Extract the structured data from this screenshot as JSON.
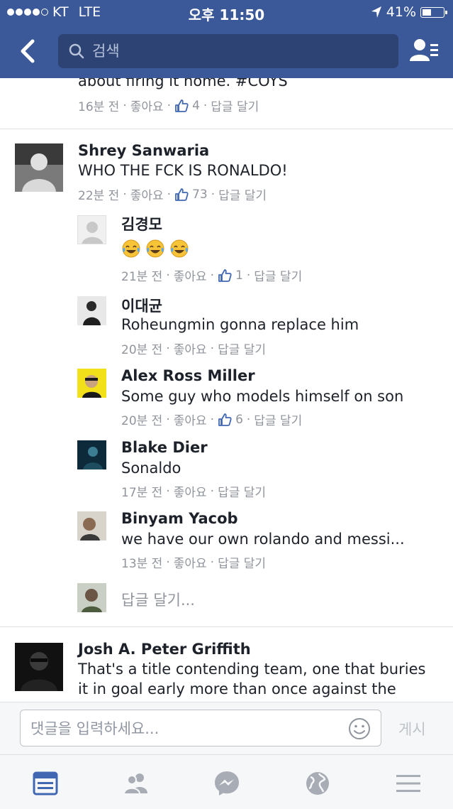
{
  "status_bar": {
    "carrier": "KT",
    "network": "LTE",
    "time": "오후 11:50",
    "battery": "41%",
    "battery_level": 0.41
  },
  "header": {
    "search_placeholder": "검색"
  },
  "comments": [
    {
      "body": "about firing it home. #COYS",
      "time": "16분 전",
      "like_label": "좋아요",
      "likes": "4",
      "reply_label": "답글 달기"
    },
    {
      "author": "Shrey Sanwaria",
      "body": "WHO THE FCK IS RONALDO!",
      "time": "22분 전",
      "like_label": "좋아요",
      "likes": "73",
      "reply_label": "답글 달기",
      "replies": [
        {
          "author": "김경모",
          "emoji": [
            "face-with-tears-of-joy",
            "face-with-tears-of-joy",
            "face-with-tears-of-joy"
          ],
          "time": "21분 전",
          "like_label": "좋아요",
          "likes": "1",
          "reply_label": "답글 달기"
        },
        {
          "author": "이대균",
          "body": "Roheungmin gonna replace him",
          "time": "20분 전",
          "like_label": "좋아요",
          "reply_label": "답글 달기"
        },
        {
          "author": "Alex Ross Miller",
          "body": "Some guy who models himself on son",
          "time": "20분 전",
          "like_label": "좋아요",
          "likes": "6",
          "reply_label": "답글 달기"
        },
        {
          "author": "Blake Dier",
          "body": "Sonaldo",
          "time": "17분 전",
          "like_label": "좋아요",
          "reply_label": "답글 달기"
        },
        {
          "author": "Binyam Yacob",
          "body": "we have our own  rolando and messi...",
          "time": "13분 전",
          "like_label": "좋아요",
          "reply_label": "답글 달기"
        }
      ],
      "reply_prompt": "답글 달기..."
    },
    {
      "author": "Josh A. Peter Griffith",
      "body_line1": "That's a title contending team, one that buries",
      "body_line2": "it in goal early more than once against the"
    }
  ],
  "composer": {
    "placeholder": "댓글을 입력하세요...",
    "post_label": "게시"
  },
  "tabbar": {
    "icons": [
      "news-feed-icon",
      "friends-icon",
      "messenger-icon",
      "notifications-globe-icon",
      "menu-icon"
    ],
    "active": "news-feed-icon"
  },
  "colors": {
    "brand": "#3b5998",
    "like_blue": "#4267b2",
    "meta_gray": "#90949c",
    "divider": "#dddfe2"
  }
}
